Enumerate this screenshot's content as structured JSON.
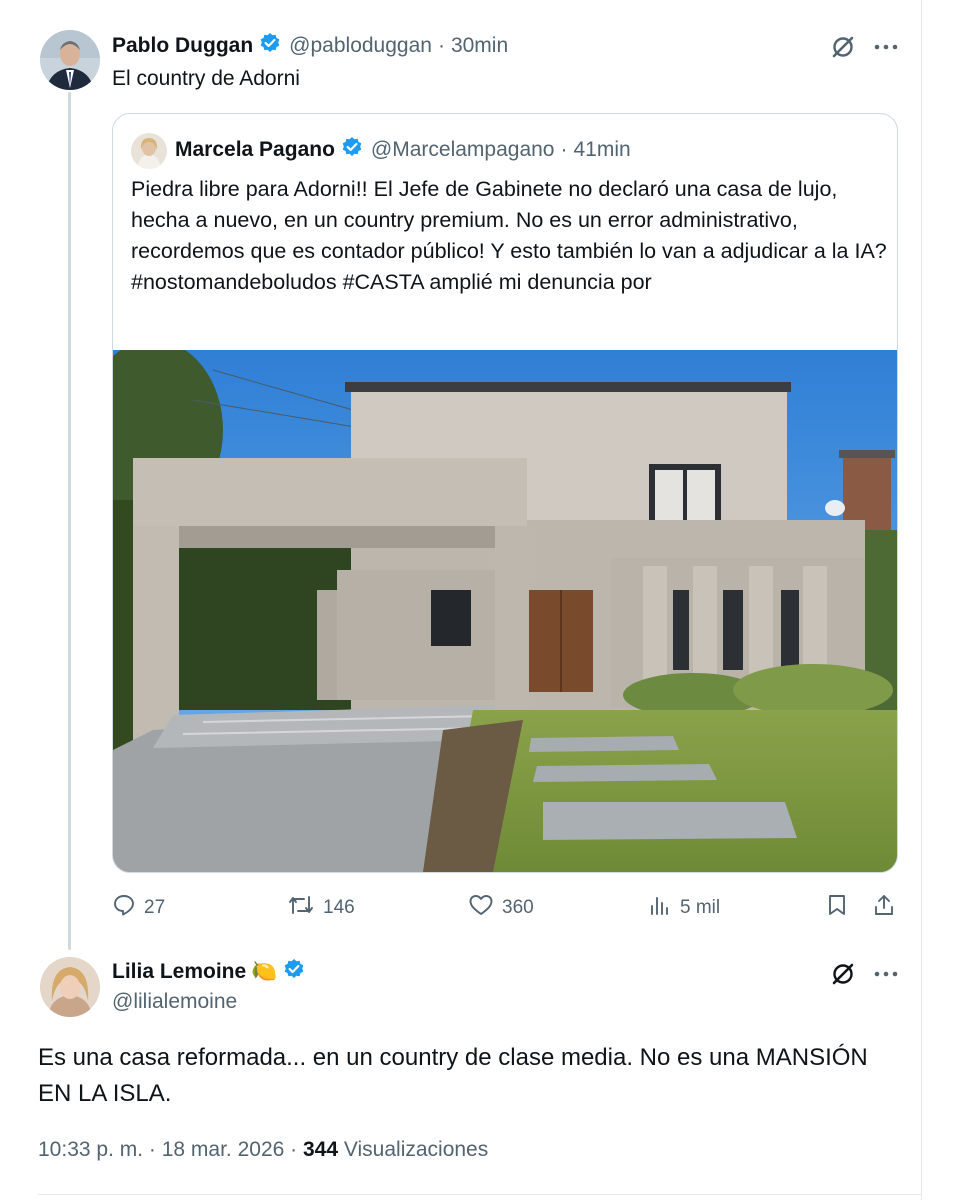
{
  "main_tweet": {
    "author_name": "Pablo Duggan",
    "handle": "@pabloduggan",
    "time": "30min",
    "text": "El country de Adorni"
  },
  "quoted_tweet": {
    "author_name": "Marcela Pagano",
    "handle": "@Marcelampagano",
    "time": "41min",
    "text": "Piedra libre para Adorni!! El Jefe de Gabinete no declaró una casa de lujo, hecha a nuevo, en un country premium. No es un error administrativo, recordemos que es contador público! Y esto también lo van a adjudicar a la IA? #nostomandeboludos #CASTA amplié mi denuncia por"
  },
  "actions": {
    "replies": "27",
    "reposts": "146",
    "likes": "360",
    "views": "5 mil"
  },
  "reply_tweet": {
    "author_name": "Lilia Lemoine",
    "emoji": "🍋",
    "handle": "@lilialemoine",
    "text": "Es una casa reformada... en un country de clase media. No es una MANSIÓN EN LA ISLA.",
    "timestamp": "10:33 p. m. · 18 mar. 2026 ·",
    "view_count": "344",
    "views_label": "Visualizaciones"
  },
  "colors": {
    "verified_blue": "#1d9bf0",
    "secondary_text": "#536471",
    "border": "#cfd9de"
  },
  "icons": [
    "verified-badge-icon",
    "grok-icon",
    "more-icon",
    "reply-icon",
    "repost-icon",
    "like-icon",
    "views-icon",
    "bookmark-icon",
    "share-icon"
  ]
}
